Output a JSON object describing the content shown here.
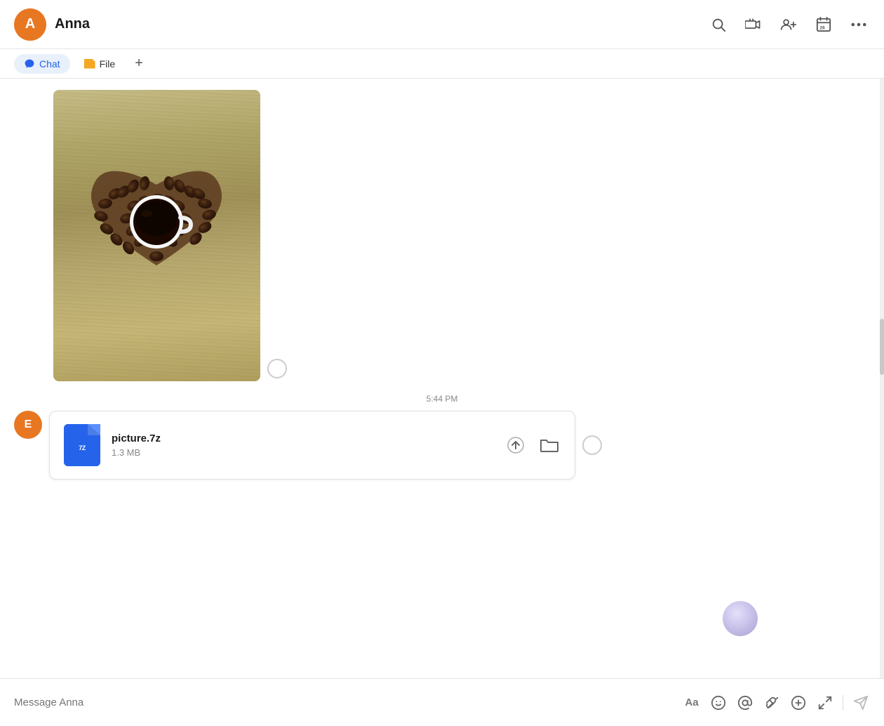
{
  "header": {
    "contact_initial": "A",
    "contact_name": "Anna",
    "avatar_color": "#E87722"
  },
  "tabs": [
    {
      "id": "chat",
      "label": "Chat",
      "active": true
    },
    {
      "id": "file",
      "label": "File",
      "active": false
    }
  ],
  "tabs_add_label": "+",
  "chat": {
    "timestamp": "5:44 PM",
    "file_message": {
      "sender_initial": "E",
      "sender_avatar_color": "#E87722",
      "file_name": "picture.7z",
      "file_size": "1.3 MB"
    }
  },
  "message_input": {
    "placeholder": "Message Anna"
  },
  "toolbar": {
    "font_icon": "Aa",
    "emoji_icon": "☺",
    "mention_icon": "@",
    "attach_icon": "✂",
    "add_icon": "⊕",
    "expand_icon": "⤢",
    "send_icon": "➤"
  },
  "header_icons": [
    {
      "name": "search",
      "symbol": "🔍"
    },
    {
      "name": "video-call",
      "symbol": "📞"
    },
    {
      "name": "add-person",
      "symbol": "👤"
    },
    {
      "name": "calendar",
      "symbol": "📅"
    },
    {
      "name": "more",
      "symbol": "•••"
    }
  ]
}
